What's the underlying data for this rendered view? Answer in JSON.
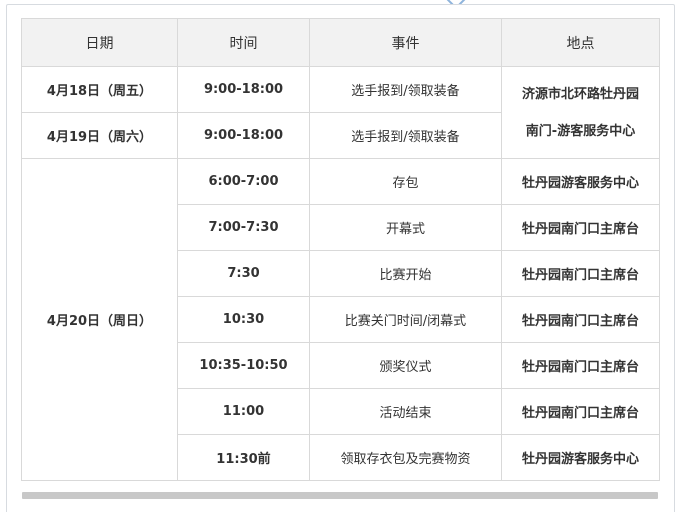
{
  "table": {
    "headers": [
      "日期",
      "时间",
      "事件",
      "地点"
    ],
    "row1": {
      "date": "4月18日（周五）",
      "time": "9:00-18:00",
      "event": "选手报到/领取装备",
      "venue_line1": "济源市北环路牡丹园",
      "venue_line2": "南门-游客服务中心"
    },
    "row2": {
      "date": "4月19日（周六）",
      "time": "9:00-18:00",
      "event": "选手报到/领取装备"
    },
    "group_date": "4月20日（周日）",
    "rows": [
      {
        "time": "6:00-7:00",
        "event": "存包",
        "venue": "牡丹园游客服务中心"
      },
      {
        "time": "7:00-7:30",
        "event": "开幕式",
        "venue": "牡丹园南门口主席台"
      },
      {
        "time": "7:30",
        "event": "比赛开始",
        "venue": "牡丹园南门口主席台"
      },
      {
        "time": "10:30",
        "event": "比赛关门时间/闭幕式",
        "venue": "牡丹园南门口主席台"
      },
      {
        "time": "10:35-10:50",
        "event": "颁奖仪式",
        "venue": "牡丹园南门口主席台"
      },
      {
        "time": "11:00",
        "event": "活动结束",
        "venue": "牡丹园南门口主席台"
      },
      {
        "time": "11:30前",
        "event": "领取存衣包及完赛物资",
        "venue": "牡丹园游客服务中心"
      }
    ]
  }
}
